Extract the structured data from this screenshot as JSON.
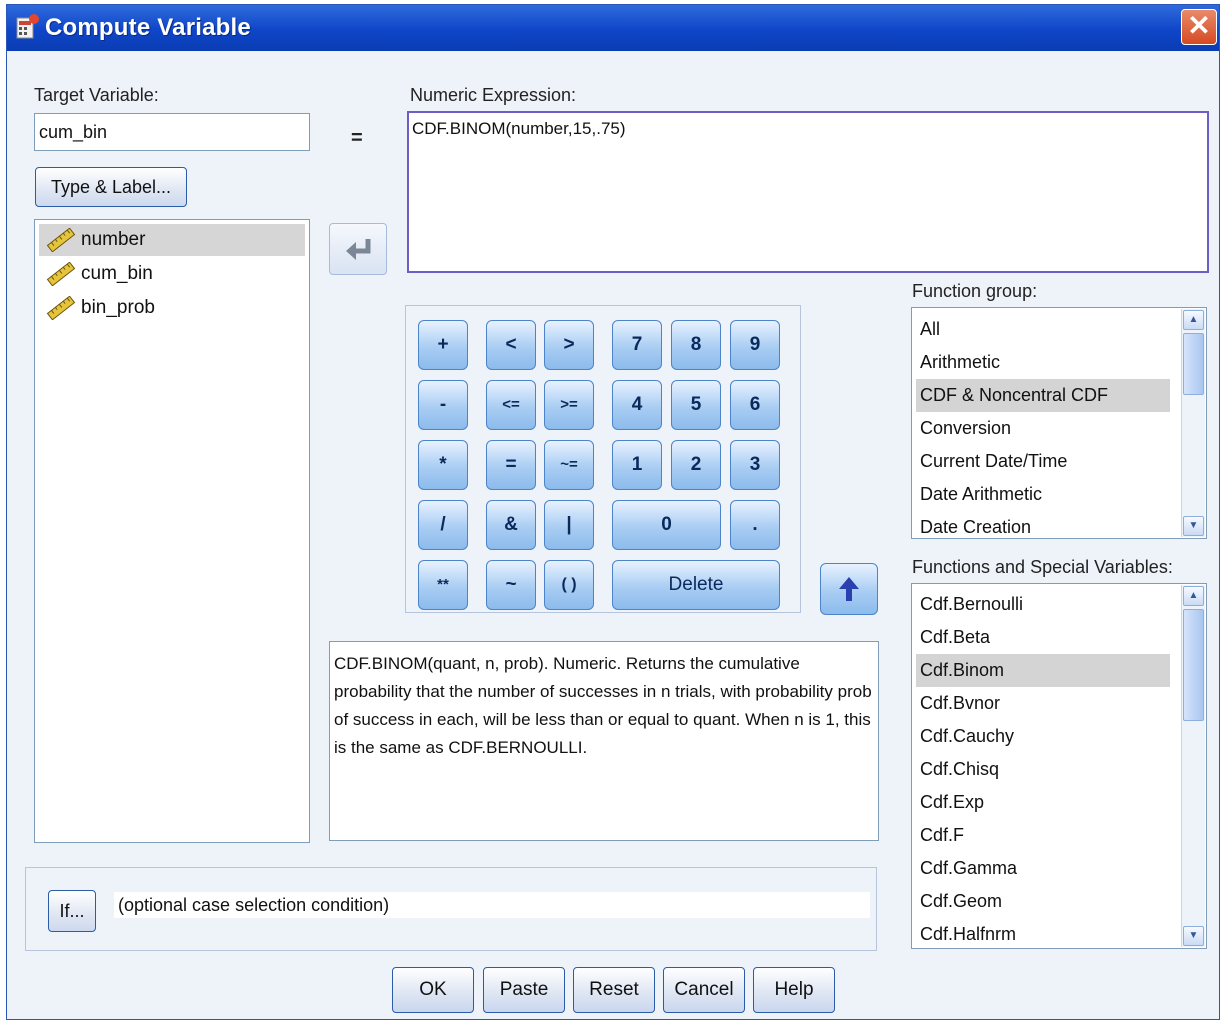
{
  "window": {
    "title": "Compute Variable",
    "close_glyph": "✕"
  },
  "target": {
    "label": "Target Variable:",
    "value": "cum_bin",
    "type_label_button": "Type & Label..."
  },
  "equals_sign": "=",
  "expression": {
    "label": "Numeric Expression:",
    "value": "CDF.BINOM(number,15,.75)"
  },
  "variables": [
    {
      "name": "number",
      "selected": true
    },
    {
      "name": "cum_bin",
      "selected": false
    },
    {
      "name": "bin_prob",
      "selected": false
    }
  ],
  "keypad": {
    "keys": [
      "+",
      "<",
      ">",
      "7",
      "8",
      "9",
      "-",
      "<=",
      ">=",
      "4",
      "5",
      "6",
      "*",
      "=",
      "~=",
      "1",
      "2",
      "3",
      "/",
      "&",
      "|",
      "0",
      ".",
      "**",
      "~",
      "( )",
      "Delete"
    ]
  },
  "function_group": {
    "label": "Function group:",
    "items": [
      "All",
      "Arithmetic",
      "CDF & Noncentral CDF",
      "Conversion",
      "Current Date/Time",
      "Date Arithmetic",
      "Date Creation"
    ],
    "selected": "CDF & Noncentral CDF"
  },
  "functions": {
    "label": "Functions and Special Variables:",
    "items": [
      "Cdf.Bernoulli",
      "Cdf.Beta",
      "Cdf.Binom",
      "Cdf.Bvnor",
      "Cdf.Cauchy",
      "Cdf.Chisq",
      "Cdf.Exp",
      "Cdf.F",
      "Cdf.Gamma",
      "Cdf.Geom",
      "Cdf.Halfnrm"
    ],
    "selected": "Cdf.Binom"
  },
  "description": "CDF.BINOM(quant, n, prob). Numeric. Returns the cumulative probability that the number of successes in n trials, with probability prob of success in each, will be less than or equal to quant. When n is 1, this is the same as CDF.BERNOULLI.",
  "if_panel": {
    "button": "If...",
    "condition": "(optional case selection condition)"
  },
  "footer": {
    "ok": "OK",
    "paste": "Paste",
    "reset": "Reset",
    "cancel": "Cancel",
    "help": "Help"
  },
  "colors": {
    "title_bar": "#0f45c8",
    "window_bg": "#eef2f9",
    "selection": "#d4d4d4",
    "key_blue": "#a9cdf3"
  }
}
